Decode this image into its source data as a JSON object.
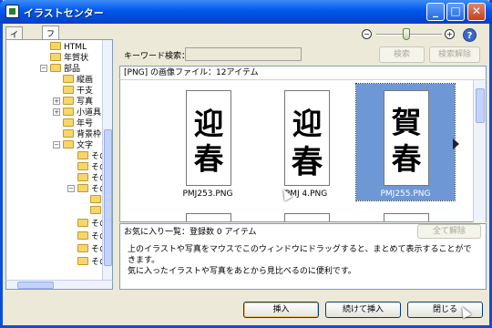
{
  "window": {
    "title": "イラストセンター"
  },
  "titlebar": {
    "minimize": "_",
    "maximize": "□",
    "close": "✕"
  },
  "tabs": [
    {
      "label": "イラスト"
    },
    {
      "label": "フォルダ"
    }
  ],
  "tree": [
    {
      "label": "HTML"
    },
    {
      "label": "年賀状"
    },
    {
      "label": "部品"
    },
    {
      "label": "縦画"
    },
    {
      "label": "干支"
    },
    {
      "label": "写真"
    },
    {
      "label": "小道具"
    },
    {
      "label": "年号"
    },
    {
      "label": "背景枠"
    },
    {
      "label": "文字"
    },
    {
      "label": "その"
    },
    {
      "label": "その"
    },
    {
      "label": "その"
    },
    {
      "label": "その"
    },
    {
      "label": ""
    },
    {
      "label": "その"
    },
    {
      "label": "その"
    },
    {
      "label": "その"
    },
    {
      "label": "その"
    }
  ],
  "toolbar": {
    "zoom_out_icon": "minus-magnifier-icon",
    "zoom_in_icon": "plus-magnifier-icon",
    "help_label": "?"
  },
  "search": {
    "label": "キーワード検索：",
    "value": "",
    "search_button": "検索",
    "clear_button": "検索解除"
  },
  "results": {
    "header": "[PNG] の画像ファイル：12アイテム",
    "items": [
      {
        "file": "PMJ253.PNG",
        "kanji_top": "迎",
        "kanji_bottom": "春",
        "selected": false
      },
      {
        "file": "PMJ254.PNG",
        "display": "PMJ  4.PNG",
        "kanji_top": "迎",
        "kanji_bottom": "春",
        "selected": false
      },
      {
        "file": "PMJ255.PNG",
        "kanji_top": "賀",
        "kanji_bottom": "春",
        "selected": true
      }
    ]
  },
  "favorites": {
    "header": "お気に入り一覧：登録数 0 アイテム",
    "clear_all": "全て解除",
    "help_line1": "上のイラストや写真をマウスでこのウィンドウにドラッグすると、まとめて表示することができます。",
    "help_line2": "気に入ったイラストや写真をあとから見比べるのに便利です。"
  },
  "footer": {
    "insert": "挿入",
    "insert_continue": "続けて挿入",
    "close": "閉じる"
  },
  "colors": {
    "titlebar": "#0058ee",
    "selection": "#6e97d6",
    "face": "#ece9d8"
  }
}
